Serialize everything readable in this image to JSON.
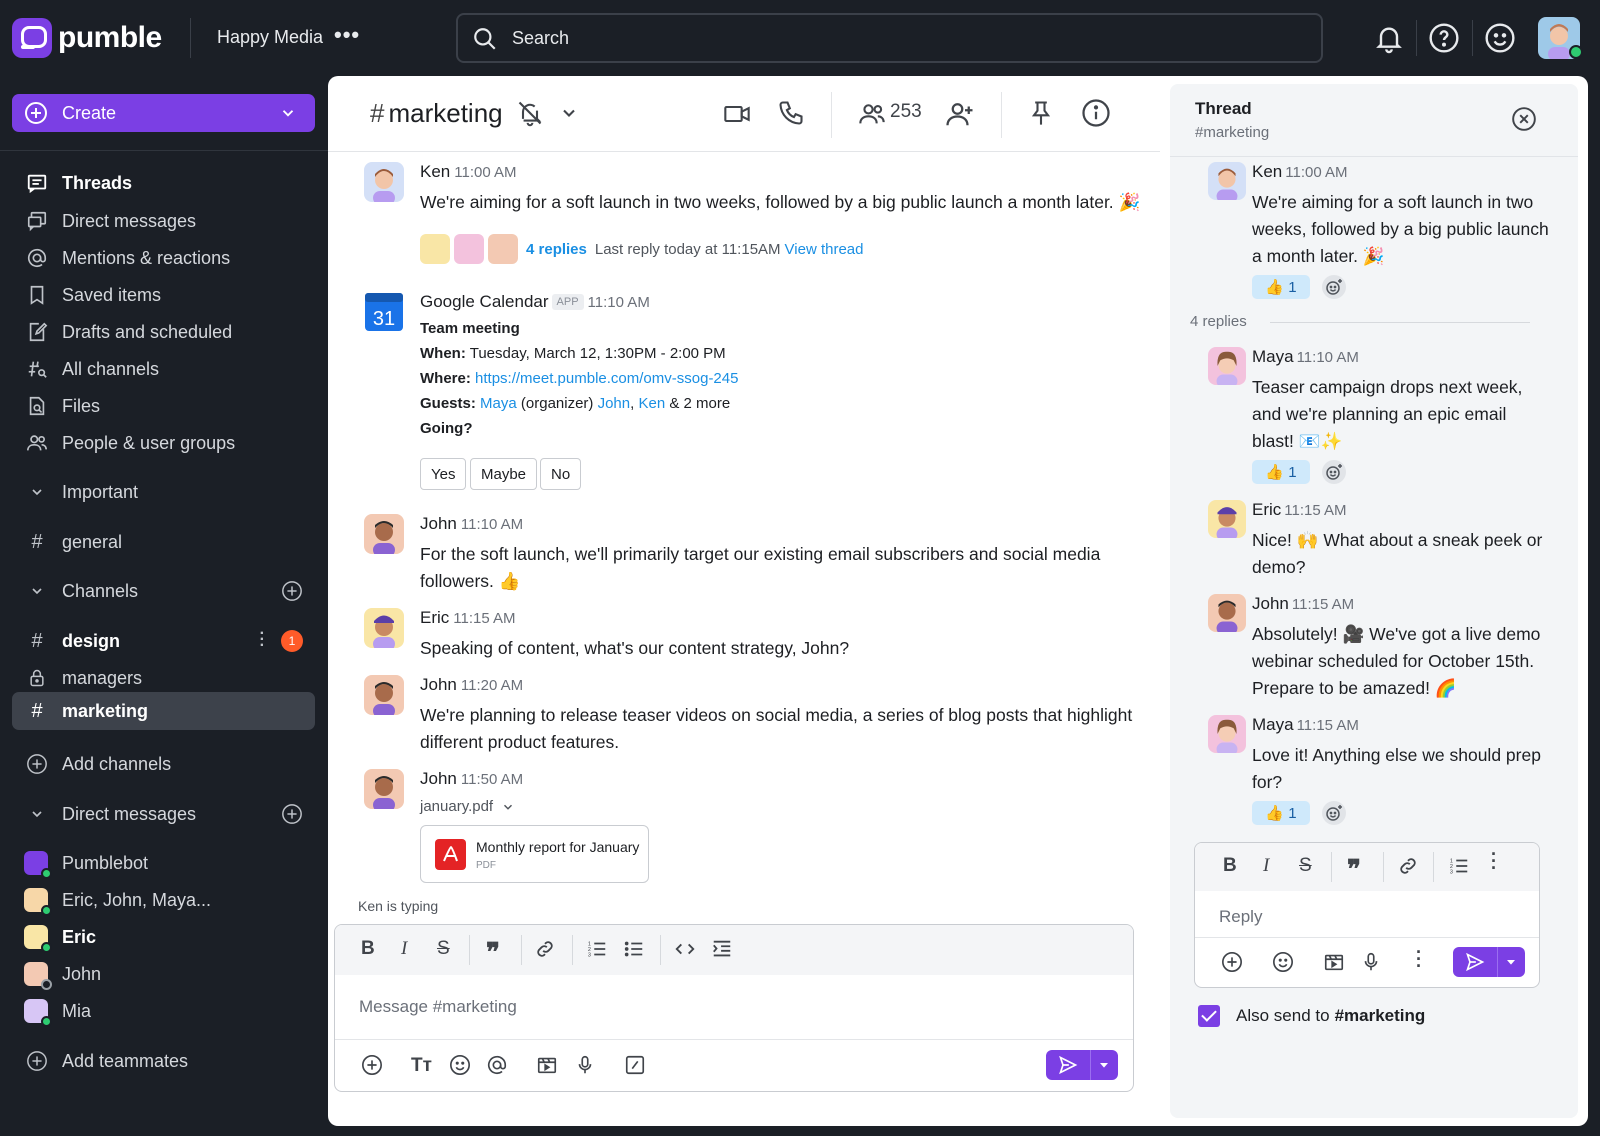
{
  "app": {
    "name": "pumble",
    "workspace": "Happy Media"
  },
  "search": {
    "placeholder": "Search"
  },
  "sidebar": {
    "create_label": "Create",
    "nav": [
      {
        "label": "Threads",
        "icon": "threads-icon"
      },
      {
        "label": "Direct messages",
        "icon": "direct-messages-icon"
      },
      {
        "label": "Mentions & reactions",
        "icon": "at-icon"
      },
      {
        "label": "Saved items",
        "icon": "bookmark-icon"
      },
      {
        "label": "Drafts and scheduled",
        "icon": "drafts-icon"
      },
      {
        "label": "All channels",
        "icon": "channels-search-icon"
      },
      {
        "label": "Files",
        "icon": "files-icon"
      },
      {
        "label": "People & user groups",
        "icon": "people-icon"
      }
    ],
    "important_label": "Important",
    "general_label": "general",
    "channels_label": "Channels",
    "channels": [
      {
        "name": "design",
        "unread": "1"
      },
      {
        "name": "managers"
      },
      {
        "name": "marketing"
      }
    ],
    "add_channels_label": "Add channels",
    "dms_label": "Direct messages",
    "dms": [
      "Pumblebot",
      "Eric, John, Maya...",
      "Eric",
      "John",
      "Mia"
    ],
    "add_teammates_label": "Add teammates"
  },
  "channel": {
    "name": "marketing",
    "member_count": "253"
  },
  "messages": [
    {
      "author": "Ken",
      "time": "11:00 AM",
      "text": "We're aiming for a soft launch in two weeks, followed by a big public launch a month later. 🎉",
      "replies": "4 replies",
      "last_reply": "Last reply today at 11:15AM",
      "view_thread": "View thread"
    },
    {
      "author": "Google Calendar",
      "tag": "APP",
      "time": "11:10 AM",
      "event": "Team meeting",
      "when_label": "When:",
      "when": "Tuesday, March 12, 1:30PM - 2:00 PM",
      "where_label": "Where:",
      "where": "https://meet.pumble.com/omv-ssog-245",
      "guests_label": "Guests:",
      "guest1": "Maya",
      "organizer": "(organizer)",
      "guest2": "John",
      "comma": ",",
      "guest3": "Ken",
      "more": "& 2 more",
      "going": "Going?",
      "yes": "Yes",
      "maybe": "Maybe",
      "no": "No",
      "calendar_day": "31"
    },
    {
      "author": "John",
      "time": "11:10 AM",
      "text": "For the soft launch, we'll primarily target our existing email subscribers and social media followers. 👍"
    },
    {
      "author": "Eric",
      "time": "11:15 AM",
      "text": "Speaking of content, what's our content strategy, John?"
    },
    {
      "author": "John",
      "time": "11:20 AM",
      "text": "We're planning to release teaser videos on social media, a series of blog posts that highlight different product features."
    },
    {
      "author": "John",
      "time": "11:50 AM",
      "file_name": "january.pdf",
      "file_title": "Monthly report for January",
      "file_type": "PDF"
    }
  ],
  "typing": "Ken is typing",
  "composer": {
    "placeholder": "Message #marketing"
  },
  "thread": {
    "title": "Thread",
    "channel": "#marketing",
    "root": {
      "author": "Ken",
      "time": "11:00 AM",
      "text": "We're aiming for a soft launch in two weeks, followed by a big public launch a month later. 🎉",
      "reaction": "👍 1"
    },
    "replies_count": "4 replies",
    "replies": [
      {
        "author": "Maya",
        "time": "11:10 AM",
        "text": "Teaser campaign drops next week, and we're planning an epic email blast! 📧✨",
        "reaction": "👍 1"
      },
      {
        "author": "Eric",
        "time": "11:15 AM",
        "text": "Nice! 🙌 What about a sneak peek or demo?"
      },
      {
        "author": "John",
        "time": "11:15 AM",
        "text": "Absolutely! 🎥 We've got a live demo webinar scheduled for October 15th. Prepare to be amazed! 🌈"
      },
      {
        "author": "Maya",
        "time": "11:15 AM",
        "text": "Love it! Anything else we should prep for?",
        "reaction": "👍 1"
      }
    ],
    "reply_placeholder": "Reply",
    "also_send_label": "Also send to",
    "also_send_channel": "#marketing"
  },
  "colors": {
    "brand": "#7b3fe4",
    "link": "#1a8fe3",
    "badge": "#ff5b29",
    "online": "#2ecc71"
  }
}
